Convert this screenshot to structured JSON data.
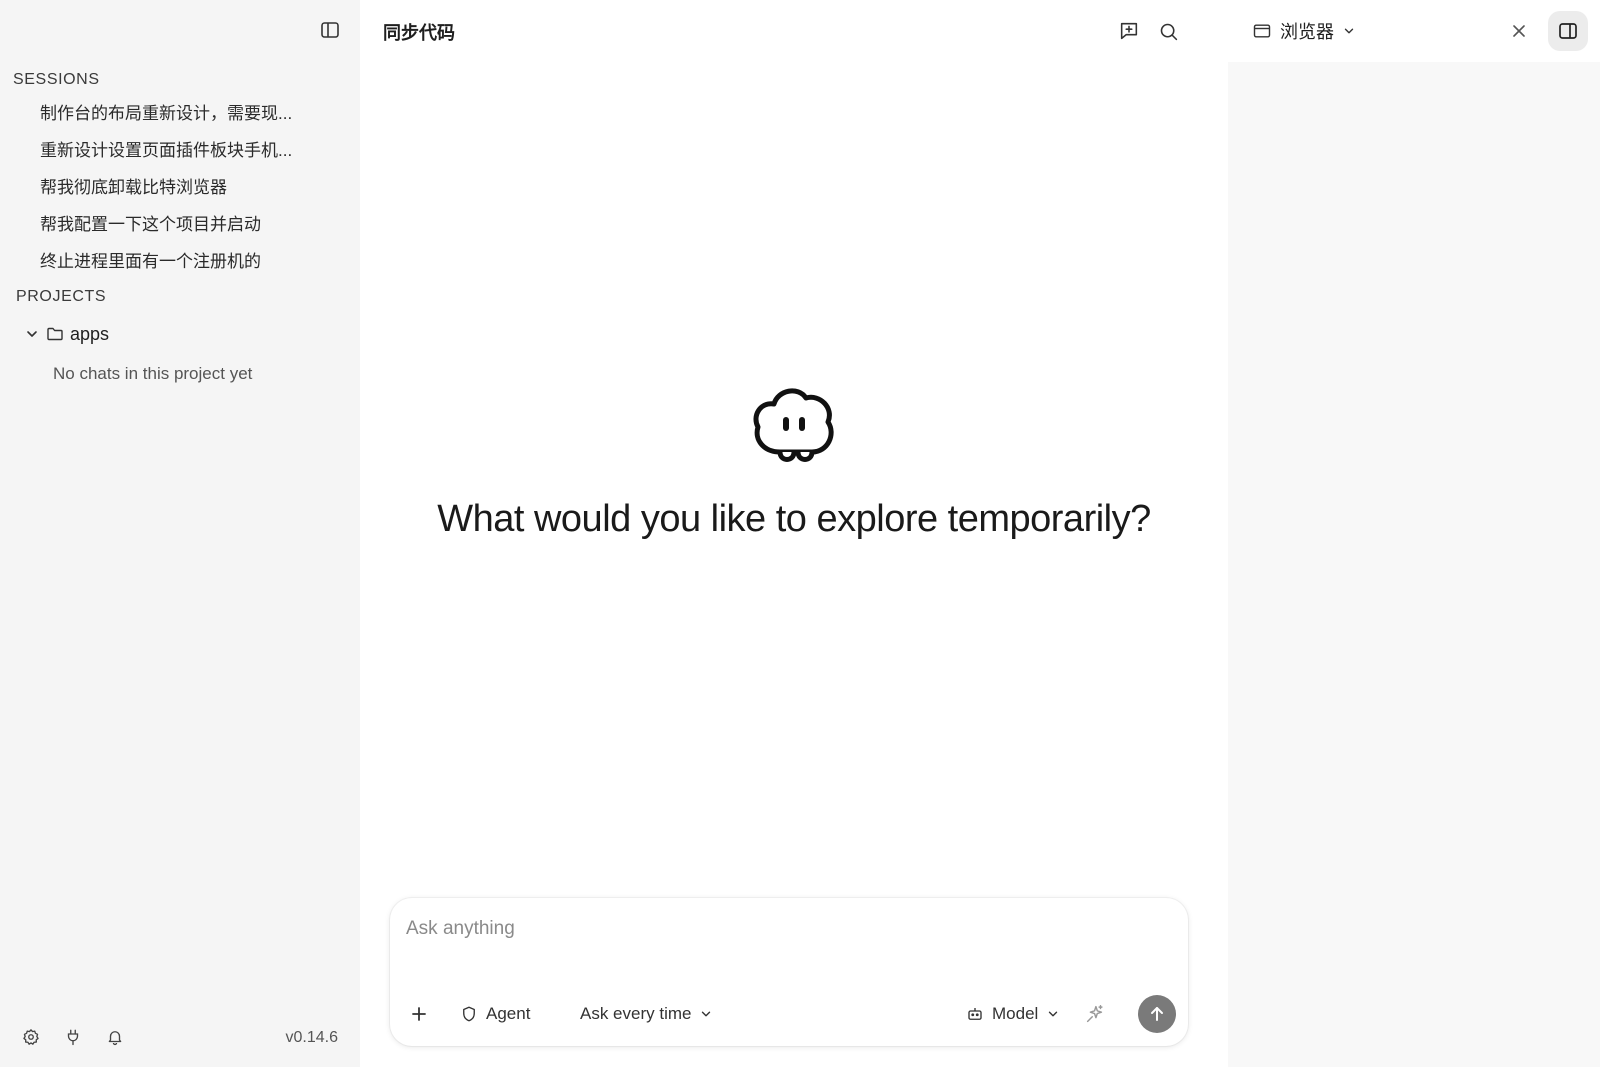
{
  "sidebar": {
    "sessions_label": "SESSIONS",
    "sessions": [
      "制作台的布局重新设计，需要现...",
      "重新设计设置页面插件板块手机...",
      "帮我彻底卸载比特浏览器",
      "帮我配置一下这个项目并启动",
      "终止进程里面有一个注册机的"
    ],
    "projects_label": "PROJECTS",
    "project": {
      "name": "apps",
      "expanded": true,
      "empty_note": "No chats in this project yet"
    },
    "footer": {
      "icons": [
        "gear-icon",
        "plug-icon",
        "bell-icon"
      ],
      "version": "v0.14.6"
    }
  },
  "main": {
    "title": "同步代码",
    "top_icons": [
      "new-chat-icon",
      "search-icon"
    ],
    "hero_title": "What would you like to explore temporarily?",
    "composer": {
      "placeholder": "Ask anything",
      "value": "",
      "add_label": "+",
      "agent_label": "Agent",
      "permission_label": "Ask every time",
      "model_label": "Model"
    }
  },
  "right_panel": {
    "browser_label": "浏览器",
    "icons": [
      "browser-window-icon",
      "chevron-down-icon",
      "close-icon",
      "panel-toggle-icon"
    ]
  },
  "colors": {
    "sidebar_bg": "#f5f5f5",
    "send_button": "#7a7a7a",
    "panel_toggle_bg": "#ececec"
  }
}
